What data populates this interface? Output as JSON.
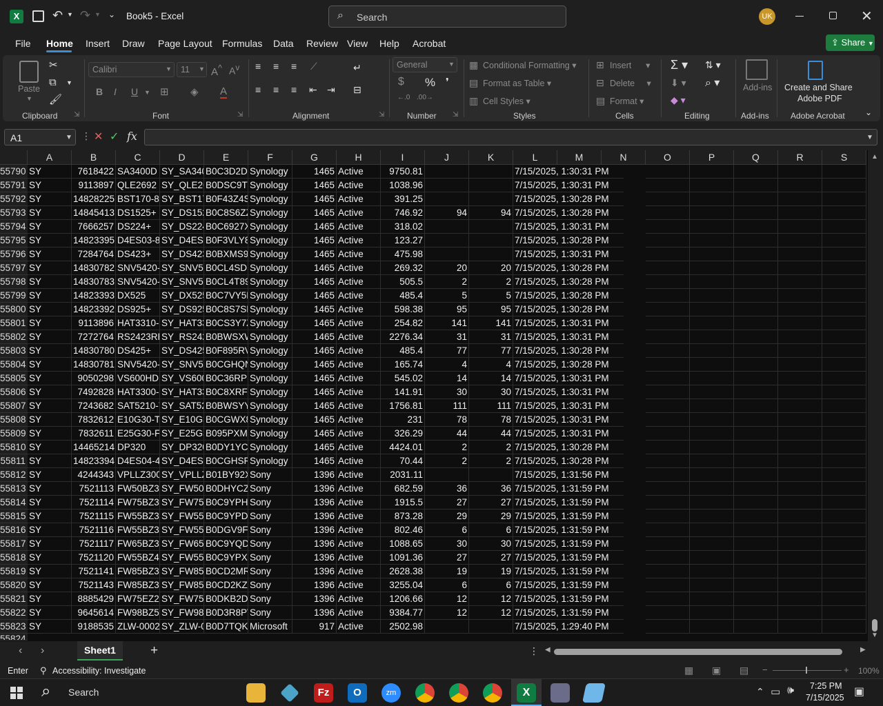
{
  "title_bar": {
    "file_name": "Book5",
    "app_name": "Excel",
    "search_placeholder": "Search",
    "user_initials": "UK"
  },
  "menu": {
    "items": [
      "File",
      "Home",
      "Insert",
      "Draw",
      "Page Layout",
      "Formulas",
      "Data",
      "Review",
      "View",
      "Help",
      "Acrobat"
    ],
    "active": "Home",
    "share_label": "Share"
  },
  "ribbon": {
    "clipboard": {
      "label": "Clipboard",
      "paste": "Paste"
    },
    "font": {
      "label": "Font",
      "font_name": "Calibri",
      "font_size": "11"
    },
    "alignment": {
      "label": "Alignment"
    },
    "number": {
      "label": "Number",
      "format": "General"
    },
    "styles": {
      "label": "Styles",
      "conditional": "Conditional Formatting",
      "format_table": "Format as Table",
      "cell_styles": "Cell Styles"
    },
    "cells": {
      "label": "Cells",
      "insert": "Insert",
      "delete": "Delete",
      "format": "Format"
    },
    "editing": {
      "label": "Editing"
    },
    "addins": {
      "label": "Add-ins",
      "btn": "Add-ins"
    },
    "acrobat": {
      "label": "Adobe Acrobat",
      "line1": "Create and Share",
      "line2": "Adobe PDF"
    }
  },
  "formula_bar": {
    "name_box": "A1",
    "fx": "fx",
    "value": ""
  },
  "columns": [
    "A",
    "B",
    "C",
    "D",
    "E",
    "F",
    "G",
    "H",
    "I",
    "J",
    "K",
    "L",
    "M",
    "N",
    "O",
    "P",
    "Q",
    "R",
    "S"
  ],
  "rows": [
    [
      "55790",
      "SY",
      "7618422",
      "SA3400D",
      "SY_SA340(",
      "B0C3D2DF",
      "Synology",
      "1465",
      "Active",
      "9750.81",
      "",
      "",
      "7/15/2025, 1:30:31 PM"
    ],
    [
      "55791",
      "SY",
      "9113897",
      "QLE2692",
      "SY_QLE26(",
      "B0DSC9TZ",
      "Synology",
      "1465",
      "Active",
      "1038.96",
      "",
      "",
      "7/15/2025, 1:30:31 PM"
    ],
    [
      "55792",
      "SY",
      "14828225",
      "BST170-8T",
      "SY_BST17(",
      "B0F43Z4SI",
      "Synology",
      "1465",
      "Active",
      "391.25",
      "",
      "",
      "7/15/2025, 1:30:28 PM"
    ],
    [
      "55793",
      "SY",
      "14845413",
      "DS1525+",
      "SY_DS152!",
      "B0C8S6ZZ\\",
      "Synology",
      "1465",
      "Active",
      "746.92",
      "94",
      "94",
      "7/15/2025, 1:30:28 PM"
    ],
    [
      "55794",
      "SY",
      "7666257",
      "DS224+",
      "SY_DS224-",
      "B0C6927XI",
      "Synology",
      "1465",
      "Active",
      "318.02",
      "",
      "",
      "7/15/2025, 1:30:31 PM"
    ],
    [
      "55795",
      "SY",
      "14823395",
      "D4ES03-8G",
      "SY_D4ES0:",
      "B0F3VLY8!",
      "Synology",
      "1465",
      "Active",
      "123.27",
      "",
      "",
      "7/15/2025, 1:30:28 PM"
    ],
    [
      "55796",
      "SY",
      "7284764",
      "DS423+",
      "SY_DS423-",
      "B0BXMS9(",
      "Synology",
      "1465",
      "Active",
      "475.98",
      "",
      "",
      "7/15/2025, 1:30:31 PM"
    ],
    [
      "55797",
      "SY",
      "14830782",
      "SNV5420-8",
      "SY_SNV54",
      "B0CL4SDK",
      "Synology",
      "1465",
      "Active",
      "269.32",
      "20",
      "20",
      "7/15/2025, 1:30:28 PM"
    ],
    [
      "55798",
      "SY",
      "14830783",
      "SNV5420-1",
      "SY_SNV54",
      "B0CL4T896",
      "Synology",
      "1465",
      "Active",
      "505.5",
      "2",
      "2",
      "7/15/2025, 1:30:28 PM"
    ],
    [
      "55799",
      "SY",
      "14823393",
      "DX525",
      "SY_DX525",
      "B0C7VY5K",
      "Synology",
      "1465",
      "Active",
      "485.4",
      "5",
      "5",
      "7/15/2025, 1:30:28 PM"
    ],
    [
      "55800",
      "SY",
      "14823392",
      "DS925+",
      "SY_DS925-",
      "B0C8S7SF4",
      "Synology",
      "1465",
      "Active",
      "598.38",
      "95",
      "95",
      "7/15/2025, 1:30:28 PM"
    ],
    [
      "55801",
      "SY",
      "9113896",
      "HAT3310-1",
      "SY_HAT33",
      "B0CS3Y7ZI",
      "Synology",
      "1465",
      "Active",
      "254.82",
      "141",
      "141",
      "7/15/2025, 1:30:31 PM"
    ],
    [
      "55802",
      "SY",
      "7272764",
      "RS2423RP-",
      "SY_RS242:",
      "B0BWSXW",
      "Synology",
      "1465",
      "Active",
      "2276.34",
      "31",
      "31",
      "7/15/2025, 1:30:31 PM"
    ],
    [
      "55803",
      "SY",
      "14830780",
      "DS425+",
      "SY_DS425-",
      "B0F895RV",
      "Synology",
      "1465",
      "Active",
      "485.4",
      "77",
      "77",
      "7/15/2025, 1:30:28 PM"
    ],
    [
      "55804",
      "SY",
      "14830781",
      "SNV5420-4",
      "SY_SNV54",
      "B0CGHQN",
      "Synology",
      "1465",
      "Active",
      "165.74",
      "4",
      "4",
      "7/15/2025, 1:30:28 PM"
    ],
    [
      "55805",
      "SY",
      "9050298",
      "VS600HD",
      "SY_VS600I",
      "B0C36RPH",
      "Synology",
      "1465",
      "Active",
      "545.02",
      "14",
      "14",
      "7/15/2025, 1:30:31 PM"
    ],
    [
      "55806",
      "SY",
      "7492828",
      "HAT3300-(",
      "SY_HAT33",
      "B0C8XRFT",
      "Synology",
      "1465",
      "Active",
      "141.91",
      "30",
      "30",
      "7/15/2025, 1:30:31 PM"
    ],
    [
      "55807",
      "SY",
      "7243682",
      "SAT5210-7",
      "SY_SAT52:",
      "B0BWSYYI",
      "Synology",
      "1465",
      "Active",
      "1756.81",
      "111",
      "111",
      "7/15/2025, 1:30:31 PM"
    ],
    [
      "55808",
      "SY",
      "7832612",
      "E10G30-T2",
      "SY_E10G3(",
      "B0CGWX8",
      "Synology",
      "1465",
      "Active",
      "231",
      "78",
      "78",
      "7/15/2025, 1:30:31 PM"
    ],
    [
      "55809",
      "SY",
      "7832611",
      "E25G30-F2",
      "SY_E25G3(",
      "B095PXMJ",
      "Synology",
      "1465",
      "Active",
      "326.29",
      "44",
      "44",
      "7/15/2025, 1:30:31 PM"
    ],
    [
      "55810",
      "SY",
      "14465214",
      "DP320",
      "SY_DP320",
      "B0DY1YC7",
      "Synology",
      "1465",
      "Active",
      "4424.01",
      "2",
      "2",
      "7/15/2025, 1:30:28 PM"
    ],
    [
      "55811",
      "SY",
      "14823394",
      "D4ES04-4G",
      "SY_D4ES0-",
      "B0CGHSF3",
      "Synology",
      "1465",
      "Active",
      "70.44",
      "2",
      "2",
      "7/15/2025, 1:30:28 PM"
    ],
    [
      "55812",
      "SY",
      "4244343",
      "VPLLZ3009",
      "SY_VPLLZ:",
      "B01BY92X!",
      "Sony",
      "1396",
      "Active",
      "2031.11",
      "",
      "",
      "7/15/2025, 1:31:56 PM"
    ],
    [
      "55813",
      "SY",
      "7521113",
      "FW50BZ30",
      "SY_FW50E",
      "B0DHYCZ3",
      "Sony",
      "1396",
      "Active",
      "682.59",
      "36",
      "36",
      "7/15/2025, 1:31:59 PM"
    ],
    [
      "55814",
      "SY",
      "7521114",
      "FW75BZ30",
      "SY_FW75E",
      "B0C9YPHG",
      "Sony",
      "1396",
      "Active",
      "1915.5",
      "27",
      "27",
      "7/15/2025, 1:31:59 PM"
    ],
    [
      "55815",
      "SY",
      "7521115",
      "FW55BZ30",
      "SY_FW55E",
      "B0C9YPDN",
      "Sony",
      "1396",
      "Active",
      "873.28",
      "29",
      "29",
      "7/15/2025, 1:31:59 PM"
    ],
    [
      "55816",
      "SY",
      "7521116",
      "FW55BZ35",
      "SY_FW55E",
      "B0DGV9FS",
      "Sony",
      "1396",
      "Active",
      "802.46",
      "6",
      "6",
      "7/15/2025, 1:31:59 PM"
    ],
    [
      "55817",
      "SY",
      "7521117",
      "FW65BZ30",
      "SY_FW65E",
      "B0C9YQD(",
      "Sony",
      "1396",
      "Active",
      "1088.65",
      "30",
      "30",
      "7/15/2025, 1:31:59 PM"
    ],
    [
      "55818",
      "SY",
      "7521120",
      "FW55BZ40",
      "SY_FW55E",
      "B0C9YPXL",
      "Sony",
      "1396",
      "Active",
      "1091.36",
      "27",
      "27",
      "7/15/2025, 1:31:59 PM"
    ],
    [
      "55819",
      "SY",
      "7521141",
      "FW85BZ30",
      "SY_FW85E",
      "B0CD2MR(",
      "Sony",
      "1396",
      "Active",
      "2628.38",
      "19",
      "19",
      "7/15/2025, 1:31:59 PM"
    ],
    [
      "55820",
      "SY",
      "7521143",
      "FW85BZ35",
      "SY_FW85E",
      "B0CD2KZT",
      "Sony",
      "1396",
      "Active",
      "3255.04",
      "6",
      "6",
      "7/15/2025, 1:31:59 PM"
    ],
    [
      "55821",
      "SY",
      "8885429",
      "FW75EZ20",
      "SY_FW75E",
      "B0DKB2D!",
      "Sony",
      "1396",
      "Active",
      "1206.66",
      "12",
      "12",
      "7/15/2025, 1:31:59 PM"
    ],
    [
      "55822",
      "SY",
      "9645614",
      "FW98BZ53",
      "SY_FW98E",
      "B0D3R8PV",
      "Sony",
      "1396",
      "Active",
      "9384.77",
      "12",
      "12",
      "7/15/2025, 1:31:59 PM"
    ],
    [
      "55823",
      "SY",
      "9188535",
      "ZLW-0002(",
      "SY_ZLW-0(",
      "B0D7TQKZ",
      "Microsoft",
      "917",
      "Active",
      "2502.98",
      "",
      "",
      "7/15/2025, 1:29:40 PM"
    ]
  ],
  "partial_row": "55824",
  "sheet_tabs": {
    "active": "Sheet1"
  },
  "status": {
    "mode": "Enter",
    "accessibility": "Accessibility: Investigate",
    "zoom": "100%"
  },
  "taskbar": {
    "search": "Search",
    "time": "7:25 PM",
    "date": "7/15/2025"
  },
  "colors": {
    "excel_green": "#107c41",
    "share_green": "#1e7b3e",
    "accent_blue": "#3b8cd9"
  }
}
